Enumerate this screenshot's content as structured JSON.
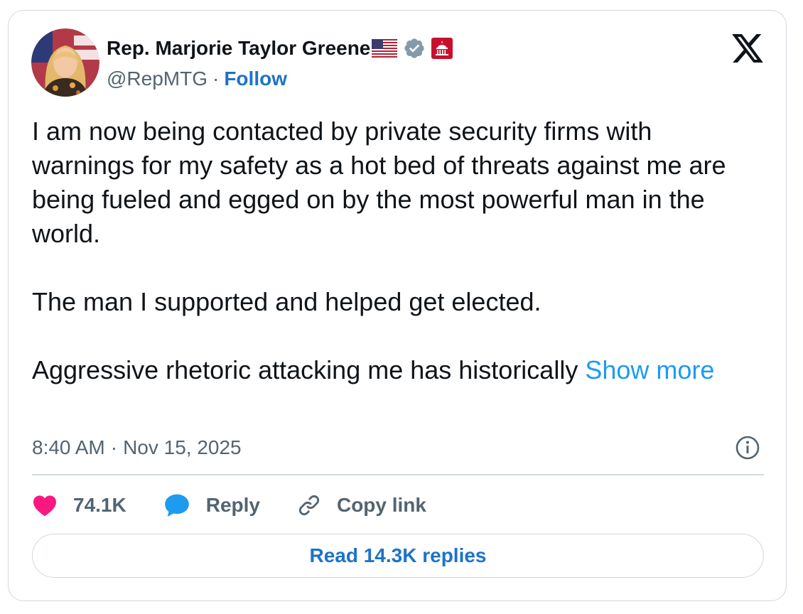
{
  "author": {
    "name": "Rep. Marjorie Taylor Greene",
    "handle": "@RepMTG",
    "separator": "·",
    "follow_label": "Follow",
    "flag_icon": "us-flag-icon",
    "verified_icon": "verified-badge-icon",
    "verified_color": "#829aab",
    "gov_badge_icon": "capitol-building-icon",
    "gov_badge_color": "#c8102e",
    "avatar_icon": "profile-avatar"
  },
  "brand": {
    "logo_icon": "x-logo-icon"
  },
  "tweet": {
    "paragraph_1": "I am now being contacted by private security firms with warnings for my safety as a hot bed of threats against me are being fueled and egged on by the most powerful man in the world.",
    "paragraph_2": "The man I supported and helped get elected.",
    "paragraph_3": "Aggressive rhetoric attacking me has historically",
    "show_more_label": "Show more",
    "show_more_color": "#1d9bf0"
  },
  "meta": {
    "time": "8:40 AM",
    "separator": "·",
    "date": "Nov 15, 2025",
    "info_icon": "info-icon"
  },
  "actions": {
    "like_count": "74.1K",
    "like_icon": "heart-icon",
    "like_color": "#f91880",
    "reply_label": "Reply",
    "reply_icon": "speech-bubble-icon",
    "reply_color": "#1d9bf0",
    "copy_link_label": "Copy link",
    "copy_link_icon": "link-icon"
  },
  "footer": {
    "read_replies_label": "Read 14.3K replies"
  }
}
